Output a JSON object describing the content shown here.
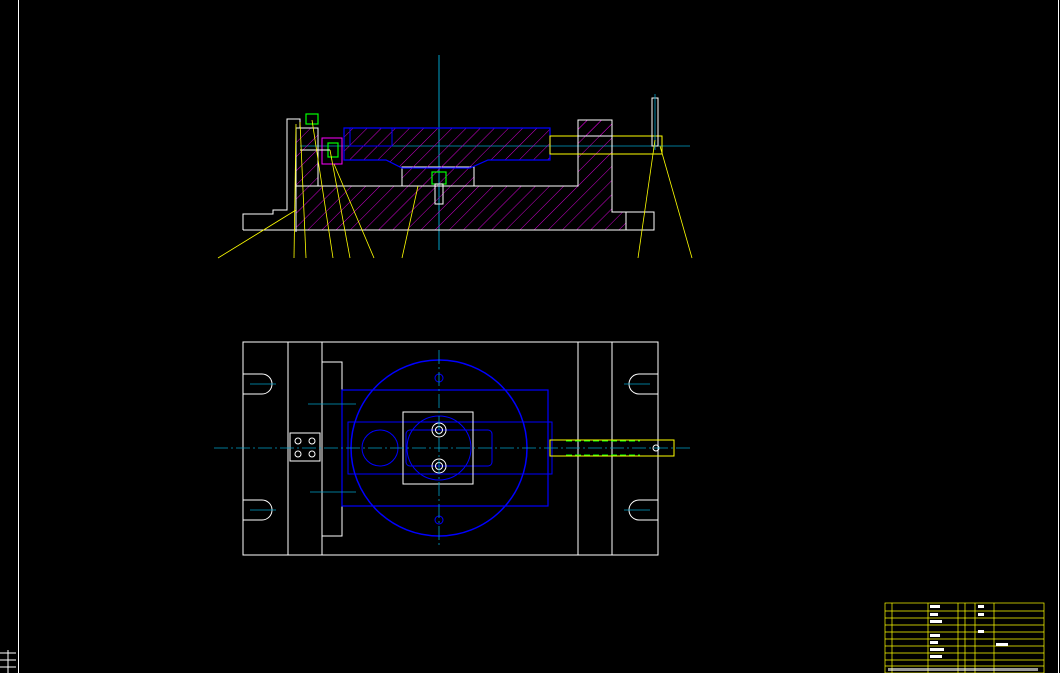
{
  "colors": {
    "background": "#000000",
    "outline": "#ffffff",
    "centerline": "#00a0c8",
    "part": "#0000ff",
    "hatch": "#ff00ff",
    "leader": "#ffff00",
    "fastener": "#00ff00",
    "title_block": "#ffff00"
  }
}
